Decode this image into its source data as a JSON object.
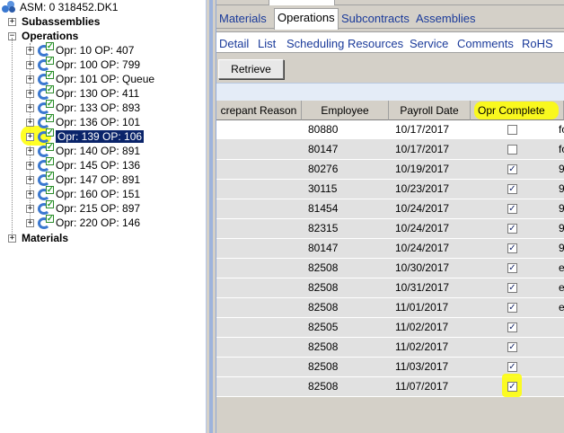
{
  "tree": {
    "root_label": "ASM: 0 318452.DK1",
    "subassemblies_label": "Subassemblies",
    "operations_label": "Operations",
    "materials_label": "Materials",
    "operations": [
      {
        "label": "Opr: 10 OP: 407"
      },
      {
        "label": "Opr: 100 OP: 799"
      },
      {
        "label": "Opr: 101 OP: Queue"
      },
      {
        "label": "Opr: 130 OP: 411"
      },
      {
        "label": "Opr: 133 OP: 893"
      },
      {
        "label": "Opr: 136 OP: 101"
      },
      {
        "label": "Opr: 139 OP: 106",
        "selected": true
      },
      {
        "label": "Opr: 140 OP: 891"
      },
      {
        "label": "Opr: 145 OP: 136"
      },
      {
        "label": "Opr: 147 OP: 891"
      },
      {
        "label": "Opr: 160 OP: 151"
      },
      {
        "label": "Opr: 215 OP: 897"
      },
      {
        "label": "Opr: 220 OP: 146"
      }
    ]
  },
  "tabs_top": [
    "Materials",
    "Operations",
    "Subcontracts",
    "Assemblies"
  ],
  "tabs_top_active": "Operations",
  "tabs_second": [
    "Detail",
    "List",
    "Scheduling Resources",
    "Service",
    "Comments",
    "RoHS"
  ],
  "retrieve_label": "Retrieve",
  "grid": {
    "headers": [
      "crepant Reason",
      "Employee",
      "Payroll Date",
      "Opr Complete"
    ],
    "rows": [
      {
        "employee": "80880",
        "date": "10/17/2017",
        "complete": false,
        "extra": "fo"
      },
      {
        "employee": "80147",
        "date": "10/17/2017",
        "complete": false,
        "extra": "fo"
      },
      {
        "employee": "80276",
        "date": "10/19/2017",
        "complete": true,
        "extra": "9"
      },
      {
        "employee": "30115",
        "date": "10/23/2017",
        "complete": true,
        "extra": "9"
      },
      {
        "employee": "81454",
        "date": "10/24/2017",
        "complete": true,
        "extra": "9"
      },
      {
        "employee": "82315",
        "date": "10/24/2017",
        "complete": true,
        "extra": "9"
      },
      {
        "employee": "80147",
        "date": "10/24/2017",
        "complete": true,
        "extra": "9"
      },
      {
        "employee": "82508",
        "date": "10/30/2017",
        "complete": true,
        "extra": "e"
      },
      {
        "employee": "82508",
        "date": "10/31/2017",
        "complete": true,
        "extra": "e"
      },
      {
        "employee": "82508",
        "date": "11/01/2017",
        "complete": true,
        "extra": "e"
      },
      {
        "employee": "82505",
        "date": "11/02/2017",
        "complete": true,
        "extra": ""
      },
      {
        "employee": "82508",
        "date": "11/02/2017",
        "complete": true,
        "extra": ""
      },
      {
        "employee": "82508",
        "date": "11/03/2017",
        "complete": true,
        "extra": ""
      },
      {
        "employee": "82508",
        "date": "11/07/2017",
        "complete": true,
        "extra": ""
      }
    ]
  },
  "colors": {
    "highlight": "#ffff00",
    "selection": "#0a246a",
    "tab_text": "#1a3a9a"
  }
}
